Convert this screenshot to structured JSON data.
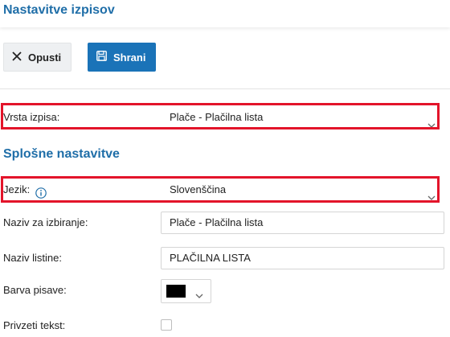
{
  "header": {
    "title": "Nastavitve izpisov"
  },
  "toolbar": {
    "cancel_label": "Opusti",
    "save_label": "Shrani",
    "cancel_icon": "close-icon",
    "save_icon": "floppy-disk-icon"
  },
  "print_type": {
    "label": "Vrsta izpisa:",
    "value": "Plače - Plačilna lista"
  },
  "general": {
    "section_title": "Splošne nastavitve",
    "language": {
      "label": "Jezik:",
      "value": "Slovenščina",
      "info_icon": "info-icon"
    },
    "selection_name": {
      "label": "Naziv za izbiranje:",
      "value": "Plače - Plačilna lista"
    },
    "document_name": {
      "label": "Naziv listine:",
      "value": "PLAČILNA LISTA"
    },
    "font_color": {
      "label": "Barva pisave:",
      "value": "#000000"
    },
    "default_text": {
      "label": "Privzeti tekst:",
      "checked": false
    }
  },
  "colors": {
    "accent": "#1f6ea8",
    "primary_button": "#1a73b8",
    "highlight": "#e3142a"
  }
}
